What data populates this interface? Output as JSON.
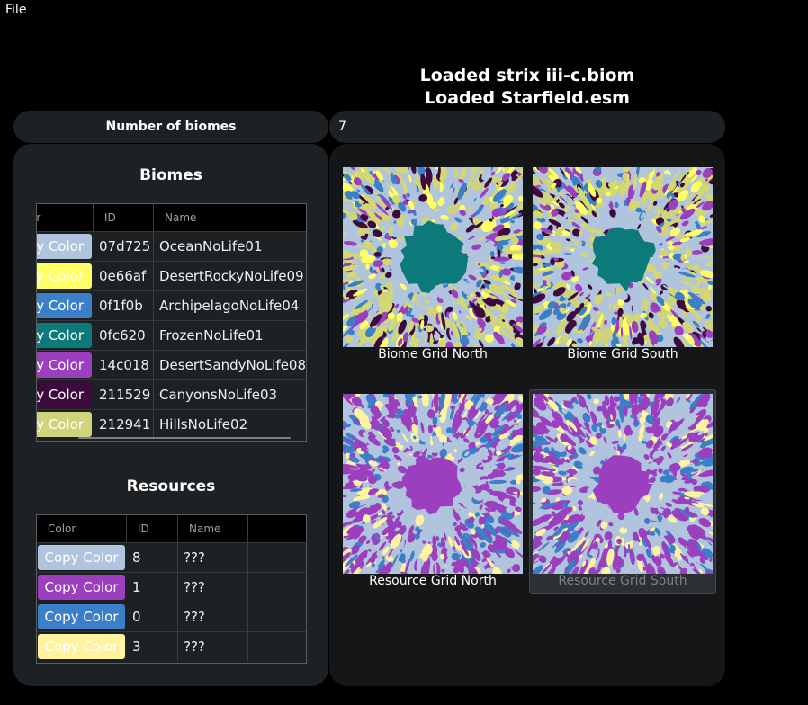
{
  "menu": {
    "file_label": "File"
  },
  "status": {
    "line1": "Loaded strix iii-c.biom",
    "line2": "Loaded Starfield.esm"
  },
  "biome_count": {
    "label": "Number of biomes",
    "value": "7"
  },
  "biomes": {
    "title": "Biomes",
    "columns": [
      "Color",
      "ID",
      "Name"
    ],
    "copy_label": "Copy Color",
    "rows": [
      {
        "id": "07d725",
        "name": "OceanNoLife01",
        "color": "#b0c4de",
        "text_color": "#ffffff"
      },
      {
        "id": "0e66af",
        "name": "DesertRockyNoLife09",
        "color": "#ffff66",
        "text_color": "#ffffff"
      },
      {
        "id": "0f1f0b",
        "name": "ArchipelagoNoLife04",
        "color": "#3a7fc8",
        "text_color": "#ffffff"
      },
      {
        "id": "0fc620",
        "name": "FrozenNoLife01",
        "color": "#0c7a7a",
        "text_color": "#ffffff"
      },
      {
        "id": "14c018",
        "name": "DesertSandyNoLife08",
        "color": "#9b3fbf",
        "text_color": "#ffffff"
      },
      {
        "id": "211529",
        "name": "CanyonsNoLife03",
        "color": "#3d0a3d",
        "text_color": "#ffffff"
      },
      {
        "id": "212941",
        "name": "HillsNoLife02",
        "color": "#cfd47a",
        "text_color": "#ffffff"
      }
    ]
  },
  "resources": {
    "title": "Resources",
    "columns": [
      "Color",
      "ID",
      "Name"
    ],
    "copy_label": "Copy Color",
    "rows": [
      {
        "id": "8",
        "name": "???",
        "color": "#b0c4de",
        "text_color": "#ffffff"
      },
      {
        "id": "1",
        "name": "???",
        "color": "#9b3fbf",
        "text_color": "#ffffff"
      },
      {
        "id": "0",
        "name": "???",
        "color": "#3a7fc8",
        "text_color": "#ffffff"
      },
      {
        "id": "3",
        "name": "???",
        "color": "#fff3a0",
        "text_color": "#ffffff"
      }
    ]
  },
  "grids": {
    "biome_north": "Biome Grid North",
    "biome_south": "Biome Grid South",
    "resource_north": "Resource Grid North",
    "resource_south": "Resource Grid South"
  },
  "palette": {
    "panel": "#1e2124",
    "header": "#000000",
    "label_dim": "#7d8288"
  }
}
